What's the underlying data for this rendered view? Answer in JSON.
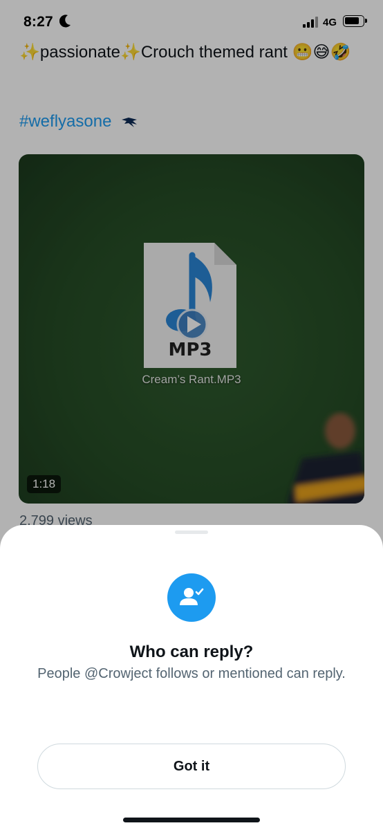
{
  "status_bar": {
    "time": "8:27",
    "network": "4G"
  },
  "tweet": {
    "text": "✨passionate✨Crouch themed rant 😬😅🤣",
    "hashtag": "#weflyasone",
    "media": {
      "file_name": "Cream’s Rant.MP3",
      "file_icon_label": "MP3",
      "duration": "1:18"
    },
    "views": "2,799 views"
  },
  "sheet": {
    "title": "Who can reply?",
    "description": "People @Crowject follows or mentioned can reply.",
    "button_label": "Got it"
  },
  "colors": {
    "accent": "#1d9bf0",
    "text": "#0f1419",
    "secondary": "#536471"
  }
}
